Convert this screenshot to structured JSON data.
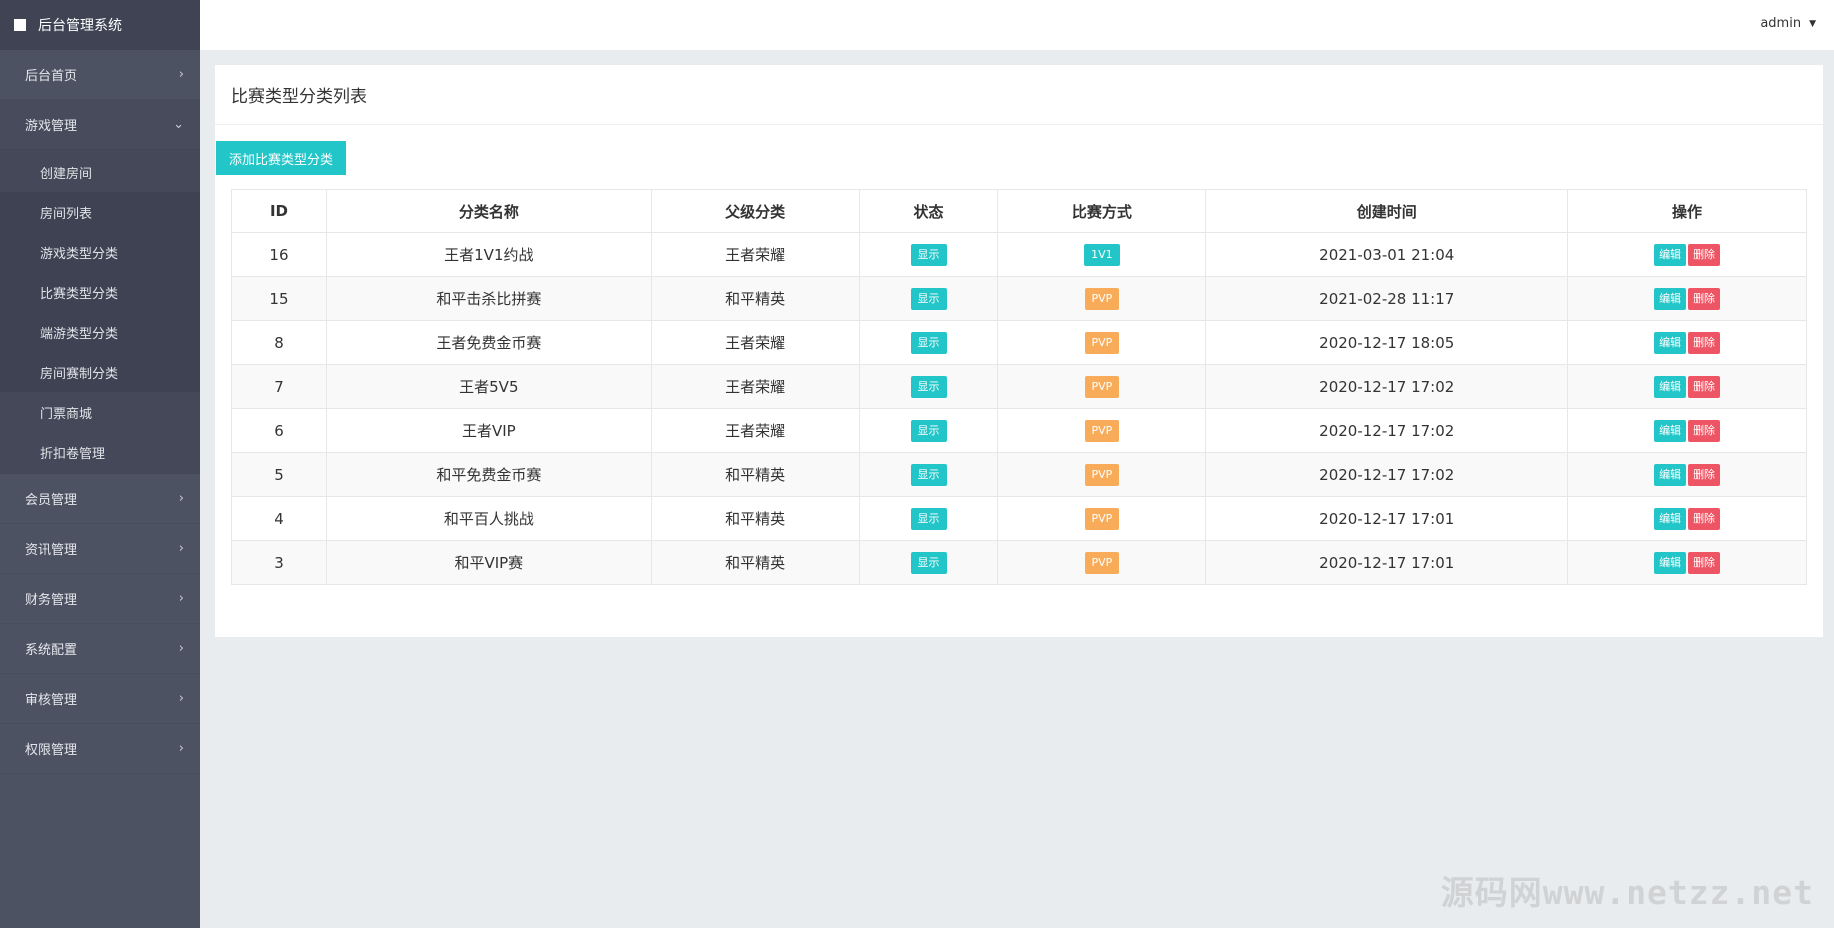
{
  "app": {
    "title": "后台管理系统"
  },
  "topbar": {
    "user": "admin"
  },
  "sidebar": {
    "items": [
      {
        "label": "后台首页"
      },
      {
        "label": "游戏管理"
      },
      {
        "label": "会员管理"
      },
      {
        "label": "资讯管理"
      },
      {
        "label": "财务管理"
      },
      {
        "label": "系统配置"
      },
      {
        "label": "审核管理"
      },
      {
        "label": "权限管理"
      }
    ],
    "sub": [
      {
        "label": "创建房间"
      },
      {
        "label": "房间列表"
      },
      {
        "label": "游戏类型分类"
      },
      {
        "label": "比赛类型分类"
      },
      {
        "label": "端游类型分类"
      },
      {
        "label": "房间赛制分类"
      },
      {
        "label": "门票商城"
      },
      {
        "label": "折扣卷管理"
      }
    ]
  },
  "page": {
    "title": "比赛类型分类列表",
    "add_button": "添加比赛类型分类"
  },
  "table": {
    "headers": [
      "ID",
      "分类名称",
      "父级分类",
      "状态",
      "比赛方式",
      "创建时间",
      "操作"
    ],
    "edit_label": "编辑",
    "delete_label": "删除",
    "rows": [
      {
        "id": "16",
        "name": "王者1V1约战",
        "parent": "王者荣耀",
        "status": "显示",
        "mode": "1V1",
        "created": "2021-03-01 21:04"
      },
      {
        "id": "15",
        "name": "和平击杀比拼赛",
        "parent": "和平精英",
        "status": "显示",
        "mode": "PVP",
        "created": "2021-02-28 11:17"
      },
      {
        "id": "8",
        "name": "王者免费金币赛",
        "parent": "王者荣耀",
        "status": "显示",
        "mode": "PVP",
        "created": "2020-12-17 18:05"
      },
      {
        "id": "7",
        "name": "王者5V5",
        "parent": "王者荣耀",
        "status": "显示",
        "mode": "PVP",
        "created": "2020-12-17 17:02"
      },
      {
        "id": "6",
        "name": "王者VIP",
        "parent": "王者荣耀",
        "status": "显示",
        "mode": "PVP",
        "created": "2020-12-17 17:02"
      },
      {
        "id": "5",
        "name": "和平免费金币赛",
        "parent": "和平精英",
        "status": "显示",
        "mode": "PVP",
        "created": "2020-12-17 17:02"
      },
      {
        "id": "4",
        "name": "和平百人挑战",
        "parent": "和平精英",
        "status": "显示",
        "mode": "PVP",
        "created": "2020-12-17 17:01"
      },
      {
        "id": "3",
        "name": "和平VIP赛",
        "parent": "和平精英",
        "status": "显示",
        "mode": "PVP",
        "created": "2020-12-17 17:01"
      }
    ]
  },
  "watermark": "源码网www.netzz.net",
  "colors": {
    "sidebar": "#4d5263",
    "accent": "#23c6c8",
    "warning": "#f8ac59",
    "danger": "#ed5565"
  }
}
